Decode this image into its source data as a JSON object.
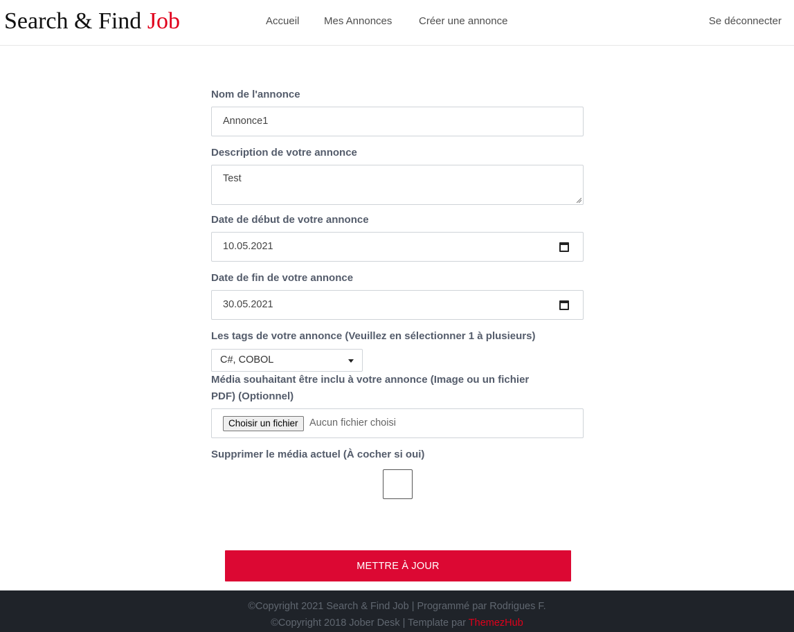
{
  "header": {
    "brand_main": "Search & Find ",
    "brand_accent": "Job",
    "nav": [
      "Accueil",
      "Mes Annonces",
      "Créer une annonce"
    ],
    "logout": "Se déconnecter"
  },
  "form": {
    "name_label": "Nom de l'annonce",
    "name_value": "Annonce1",
    "description_label": "Description de votre annonce",
    "description_value": "Test",
    "start_label": "Date de début de votre annonce",
    "start_value": "10.05.2021",
    "end_label": "Date de fin de votre annonce",
    "end_value": "30.05.2021",
    "tags_label": "Les tags de votre annonce (Veuillez en sélectionner 1 à plusieurs)",
    "tags_value": "C#, COBOL",
    "media_label_1": "Média souhaitant être inclu à votre annonce (Image ou un fichier",
    "media_label_2": "PDF) (Optionnel)",
    "file_button": "Choisir un fichier",
    "file_status": "Aucun fichier choisi",
    "delete_media_label": "Supprimer le média actuel (À cocher si oui)",
    "delete_media_checked": false,
    "submit_label": "METTRE À JOUR"
  },
  "footer": {
    "line1": "©Copyright 2021 Search & Find Job | Programmé par Rodrigues F.",
    "line2_prefix": "©Copyright 2018 Jober Desk | Template par ",
    "line2_link": "ThemezHub"
  },
  "colors": {
    "accent": "#dc0833",
    "footer_bg": "#1f2329"
  }
}
